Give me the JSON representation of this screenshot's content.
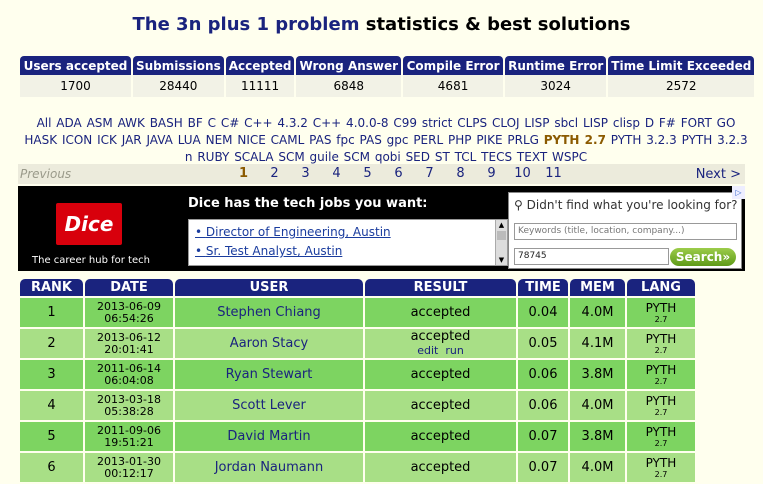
{
  "title": {
    "highlight": "The 3n plus 1 problem",
    "rest": "statistics & best solutions"
  },
  "stats": {
    "headers": [
      "Users accepted",
      "Submissions",
      "Accepted",
      "Wrong Answer",
      "Compile Error",
      "Runtime Error",
      "Time Limit Exceeded"
    ],
    "values": [
      "1700",
      "28440",
      "11111",
      "6848",
      "4681",
      "3024",
      "2572"
    ]
  },
  "languages": {
    "items": [
      "All",
      "ADA",
      "ASM",
      "AWK",
      "BASH",
      "BF",
      "C",
      "C#",
      "C++ 4.3.2",
      "C++ 4.0.0-8",
      "C99 strict",
      "CLPS",
      "CLOJ",
      "LISP sbcl",
      "LISP clisp",
      "D",
      "F#",
      "FORT",
      "GO",
      "HASK",
      "ICON",
      "ICK",
      "JAR",
      "JAVA",
      "LUA",
      "NEM",
      "NICE",
      "CAML",
      "PAS fpc",
      "PAS gpc",
      "PERL",
      "PHP",
      "PIKE",
      "PRLG",
      "PYTH 2.7",
      "PYTH 3.2.3",
      "PYTH 3.2.3 n",
      "RUBY",
      "SCALA",
      "SCM guile",
      "SCM qobi",
      "SED",
      "ST",
      "TCL",
      "TECS",
      "TEXT",
      "WSPC"
    ],
    "active": "PYTH 2.7"
  },
  "pager": {
    "prev": "Previous",
    "next": "Next >",
    "pages": [
      "1",
      "2",
      "3",
      "4",
      "5",
      "6",
      "7",
      "8",
      "9",
      "10",
      "11"
    ],
    "current": "1"
  },
  "ad": {
    "logo": "Dice",
    "tagline": "The career hub for tech",
    "headline": "Dice has the tech jobs you want:",
    "jobs": [
      "Director of Engineering, Austin",
      "Sr. Test Analyst, Austin"
    ],
    "search_question": "Didn't find what you're looking for?",
    "keywords_placeholder": "Keywords (title, location, company...)",
    "zip_value": "78745",
    "search_button": "Search»"
  },
  "ranking": {
    "headers": [
      "RANK",
      "DATE",
      "USER",
      "RESULT",
      "TIME",
      "MEM",
      "LANG"
    ],
    "rows": [
      {
        "rank": "1",
        "date": "2013-06-09",
        "clock": "06:54:26",
        "user": "Stephen Chiang",
        "result": "accepted",
        "edit": "",
        "run": "",
        "time": "0.04",
        "mem": "4.0M",
        "lang": "PYTH",
        "ver": "2.7"
      },
      {
        "rank": "2",
        "date": "2013-06-12",
        "clock": "20:01:41",
        "user": "Aaron Stacy",
        "result": "accepted",
        "edit": "edit",
        "run": "run",
        "time": "0.05",
        "mem": "4.1M",
        "lang": "PYTH",
        "ver": "2.7"
      },
      {
        "rank": "3",
        "date": "2011-06-14",
        "clock": "06:04:08",
        "user": "Ryan Stewart",
        "result": "accepted",
        "edit": "",
        "run": "",
        "time": "0.06",
        "mem": "3.8M",
        "lang": "PYTH",
        "ver": "2.7"
      },
      {
        "rank": "4",
        "date": "2013-03-18",
        "clock": "05:38:28",
        "user": "Scott Lever",
        "result": "accepted",
        "edit": "",
        "run": "",
        "time": "0.06",
        "mem": "4.0M",
        "lang": "PYTH",
        "ver": "2.7"
      },
      {
        "rank": "5",
        "date": "2011-09-06",
        "clock": "19:51:21",
        "user": "David Martin",
        "result": "accepted",
        "edit": "",
        "run": "",
        "time": "0.07",
        "mem": "3.8M",
        "lang": "PYTH",
        "ver": "2.7"
      },
      {
        "rank": "6",
        "date": "2013-01-30",
        "clock": "00:12:17",
        "user": "Jordan Naumann",
        "result": "accepted",
        "edit": "",
        "run": "",
        "time": "0.07",
        "mem": "4.0M",
        "lang": "PYTH",
        "ver": "2.7"
      }
    ]
  },
  "colors": {
    "header_navy": "#1a237e",
    "row_green_dark": "#7dd461",
    "row_green_light": "#a8df86",
    "active_lang": "#8b5a00"
  }
}
